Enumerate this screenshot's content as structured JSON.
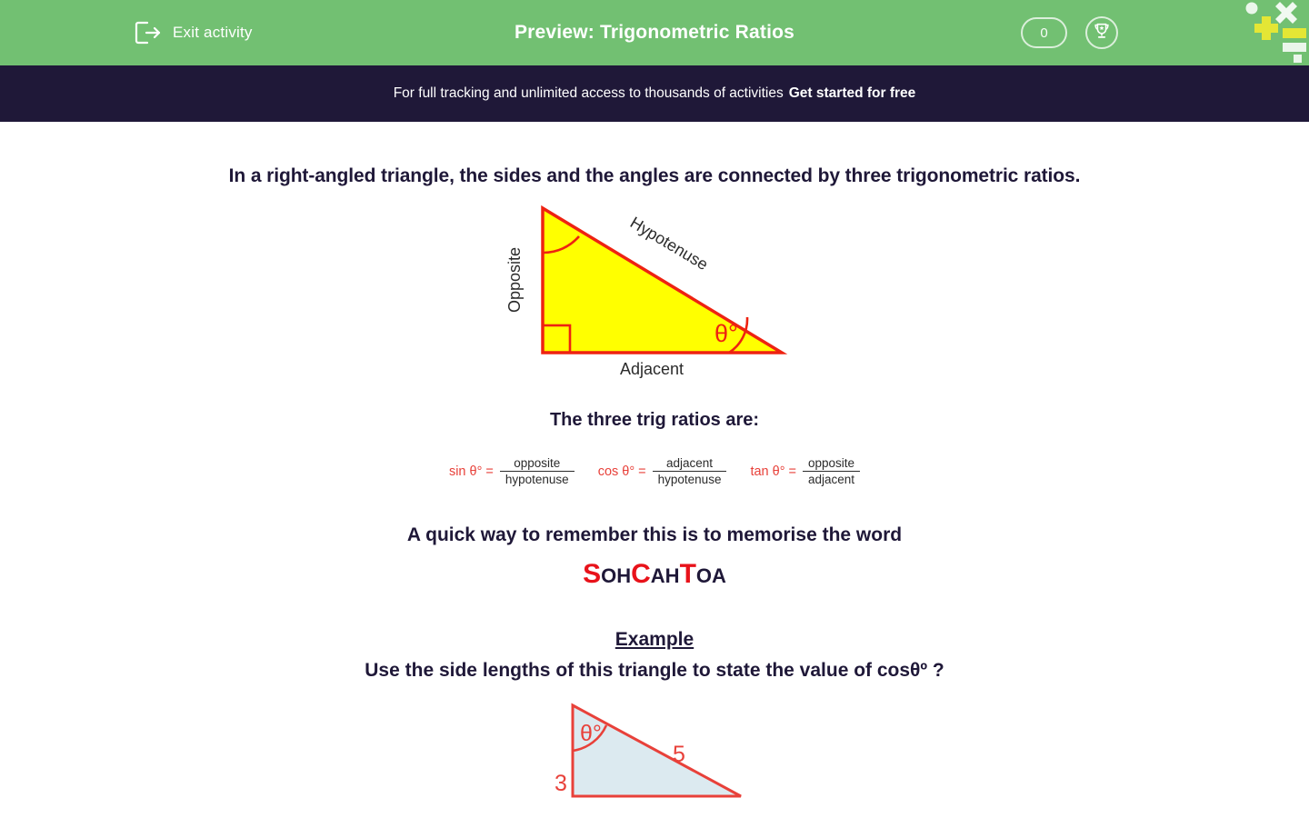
{
  "header": {
    "exit_label": "Exit activity",
    "exit_icon": "exit-arrow-icon",
    "title": "Preview: Trigonometric Ratios",
    "coin_count": "0",
    "trophy_icon": "trophy-icon",
    "bg_color": "#72c072"
  },
  "promo": {
    "text": "For full tracking and unlimited access to thousands of activities",
    "cta": "Get started for free",
    "bg_color": "#1f1838"
  },
  "main": {
    "lead_text": "In a right-angled triangle, the sides and the angles are connected by three trigonometric ratios.",
    "section_head": "The three trig ratios are:",
    "memorise_text": "A quick way to remember this is to memorise the word",
    "example_title": "Example",
    "example_question": "Use the side lengths of this triangle to state the value of cosθº ?"
  },
  "diagram": {
    "label_opposite": "Opposite",
    "label_adjacent": "Adjacent",
    "label_hypotenuse": "Hypotenuse",
    "label_theta": "θ°",
    "fill_color": "#ffff00",
    "stroke_color": "#ee2211"
  },
  "ratios": [
    {
      "name": "sin θ° =",
      "numerator": "opposite",
      "denominator": "hypotenuse"
    },
    {
      "name": "cos θ° =",
      "numerator": "adjacent",
      "denominator": "hypotenuse"
    },
    {
      "name": "tan θ° =",
      "numerator": "opposite",
      "denominator": "adjacent"
    }
  ],
  "sohcahtoa": {
    "s": "S",
    "oh": "OH",
    "c": "C",
    "ah": "AH",
    "t": "T",
    "oa": "OA",
    "accent_color": "#e8121a"
  },
  "example_diagram": {
    "label_theta": "θ°",
    "side_vertical": "3",
    "side_hypotenuse": "5",
    "fill_color": "#dceaf0",
    "stroke_color": "#e8413a"
  }
}
